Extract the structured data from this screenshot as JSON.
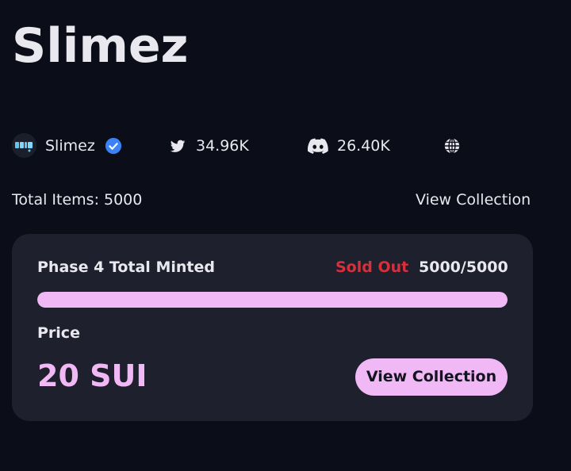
{
  "collection": {
    "title": "Slimez",
    "creator_name": "Slimez",
    "avatar_icon": "drip-logo",
    "verified_icon": "verified-check-icon",
    "twitter_followers": "34.96K",
    "discord_members": "26.40K",
    "total_items_label": "Total Items: 5000",
    "view_collection_link": "View Collection"
  },
  "mint_card": {
    "phase_label": "Phase 4 Total Minted",
    "status": "Sold Out",
    "minted": "5000/5000",
    "progress_fraction": 1.0,
    "price_label": "Price",
    "price_value": "20 SUI",
    "button_label": "View Collection"
  },
  "colors": {
    "background": "#0b0d19",
    "card": "#1f202d",
    "accent_pink": "#f0b8f4",
    "sold_out_red": "#d8303a",
    "verified_blue": "#3b82f6"
  }
}
